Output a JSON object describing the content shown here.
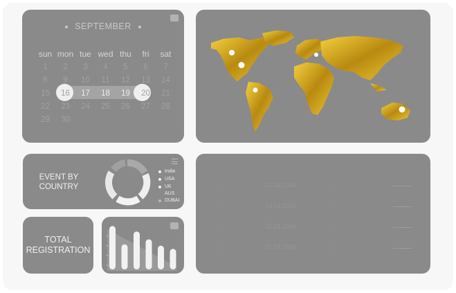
{
  "calendar": {
    "month": "SEPTEMBER",
    "weekdays": [
      "sun",
      "mon",
      "tue",
      "wed",
      "thu",
      "fri",
      "sat"
    ],
    "weeks": [
      [
        "1",
        "2",
        "3",
        "4",
        "5",
        "6",
        "7"
      ],
      [
        "8",
        "9",
        "10",
        "11",
        "12",
        "13",
        "14"
      ],
      [
        "15",
        "16",
        "17",
        "18",
        "19",
        "20",
        "21"
      ],
      [
        "22",
        "23",
        "24",
        "25",
        "26",
        "27",
        "28"
      ],
      [
        "29",
        "30",
        "",
        "",
        "",
        "",
        ""
      ]
    ],
    "selected_start": "16",
    "selected_end": "20"
  },
  "event_by_country": {
    "title": "EVENT BY COUNTRY",
    "legend": [
      "India",
      "USA",
      "UK",
      "AUS",
      "DUBAI"
    ]
  },
  "total_registration": {
    "title": "TOTAL REGISTRATION"
  },
  "chart_data": {
    "type": "bar",
    "values": [
      0.95,
      0.55,
      0.83,
      0.66,
      0.52,
      0.45
    ]
  },
  "table": {
    "rows": [
      {
        "date": "12.03.2024"
      },
      {
        "date": "14.03.2024"
      },
      {
        "date": "15.03.2024"
      },
      {
        "date": "21.03.2024"
      }
    ]
  },
  "colors": {
    "card": "#8a8a8a",
    "gold": "#d4a718",
    "highlight": "#efefef"
  }
}
